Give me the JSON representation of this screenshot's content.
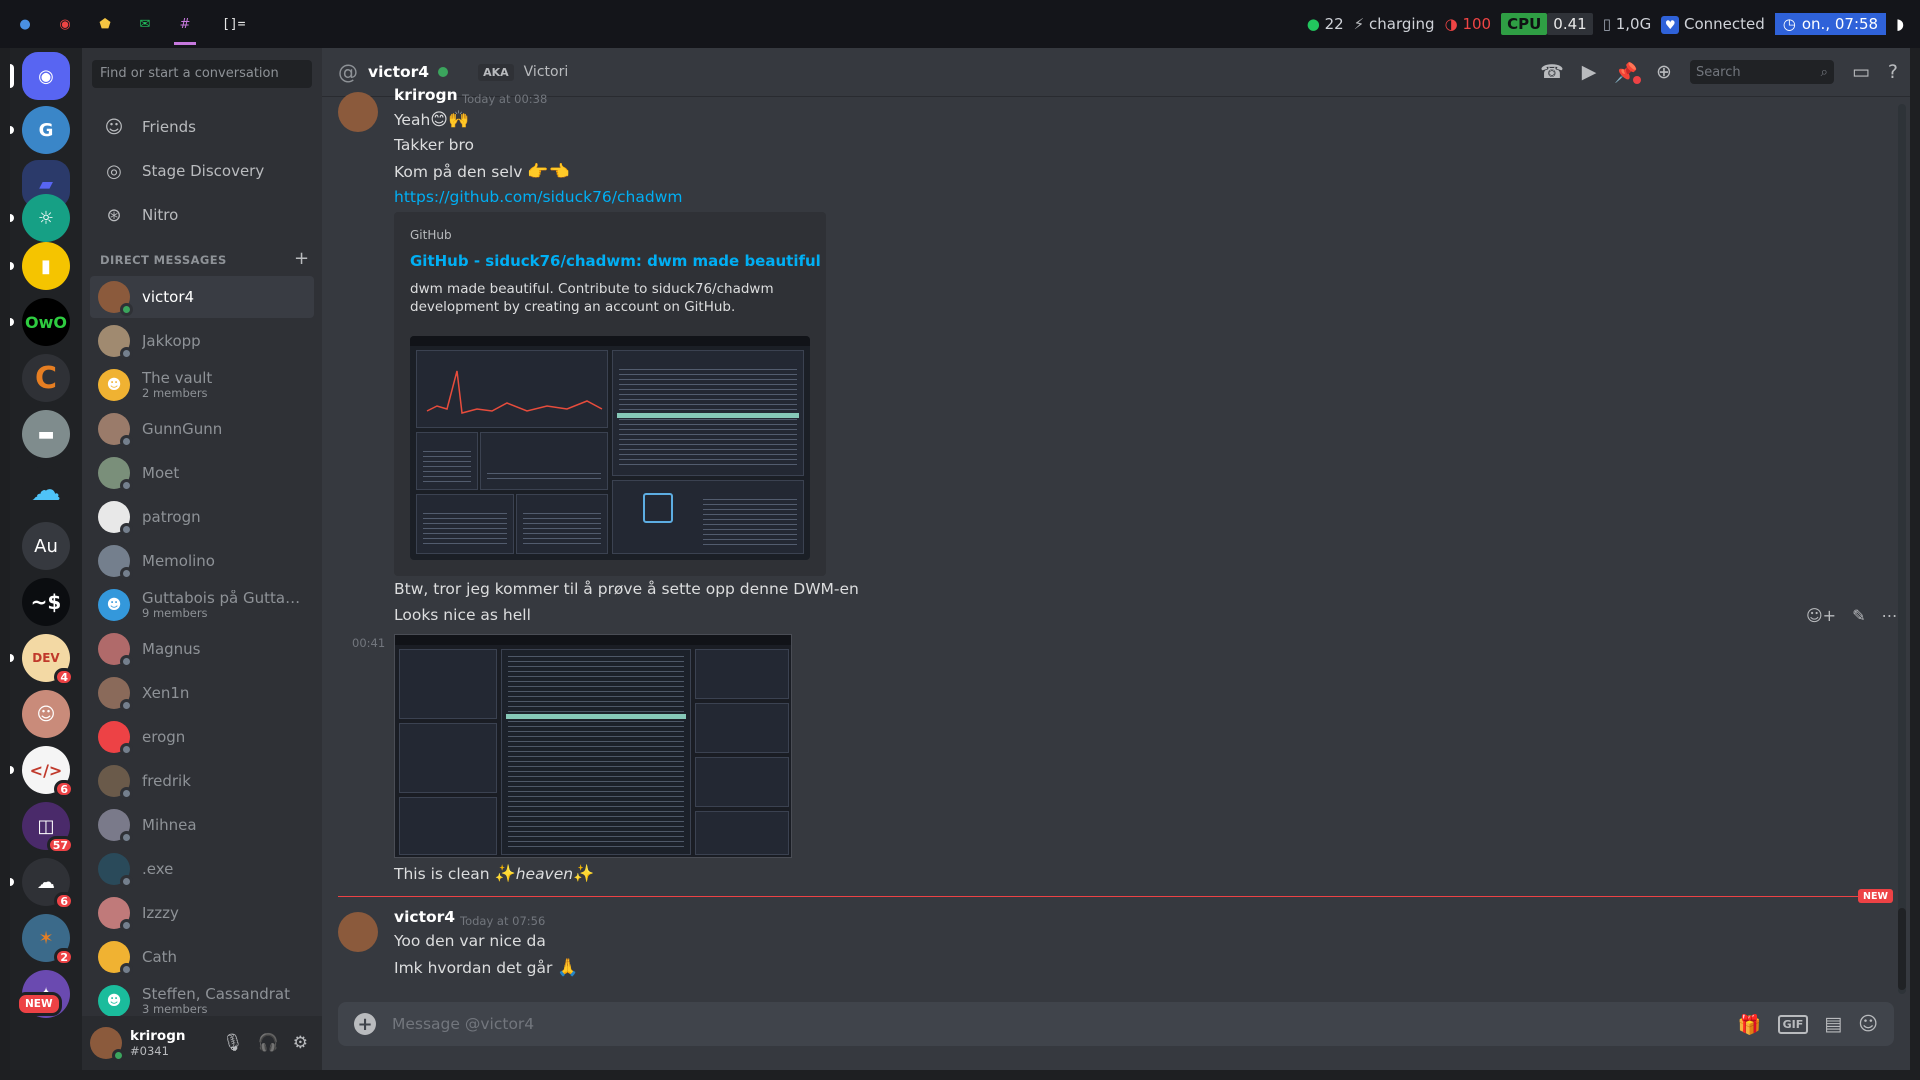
{
  "sysbar": {
    "layout_symbol": "[]=",
    "updates": "22",
    "battery_status": "charging",
    "battery_level": "100",
    "cpu_label": "CPU",
    "cpu_value": "0.41",
    "mem_value": "1,0G",
    "vpn_status": "Connected",
    "clock": "on., 07:58"
  },
  "servers": [
    {
      "name": "Discord Home",
      "badge": ""
    },
    {
      "name": "G",
      "badge": ""
    },
    {
      "name": "Folder",
      "badge": ""
    },
    {
      "name": "Owl server",
      "badge": ""
    },
    {
      "name": "Yellow server",
      "badge": ""
    },
    {
      "name": "OwO",
      "badge": ""
    },
    {
      "name": "Orange C",
      "badge": ""
    },
    {
      "name": "Car server",
      "badge": ""
    },
    {
      "name": "Cloud server",
      "badge": ""
    },
    {
      "name": "Au",
      "badge": ""
    },
    {
      "name": "~$",
      "badge": ""
    },
    {
      "name": "Bowser",
      "badge": "4"
    },
    {
      "name": "Face",
      "badge": ""
    },
    {
      "name": "Code",
      "badge": "6"
    },
    {
      "name": "Robot",
      "badge": "57"
    },
    {
      "name": "Weather",
      "badge": "6"
    },
    {
      "name": "Crab",
      "badge": "2"
    },
    {
      "name": "New",
      "badge": ""
    }
  ],
  "sidebar": {
    "search_placeholder": "Find or start a conversation",
    "nav": [
      {
        "label": "Friends"
      },
      {
        "label": "Stage Discovery"
      },
      {
        "label": "Nitro"
      }
    ],
    "dm_header": "DIRECT MESSAGES",
    "dms": [
      {
        "name": "victor4",
        "sub": "",
        "color": "#8b5a3c",
        "online": true
      },
      {
        "name": "Jakkopp",
        "sub": "",
        "color": "#a08a70",
        "online": false
      },
      {
        "name": "The vault",
        "sub": "2 members",
        "color": "#f0b232",
        "online": false
      },
      {
        "name": "GunnGunn",
        "sub": "",
        "color": "#9a7b6a",
        "online": false
      },
      {
        "name": "Moet",
        "sub": "",
        "color": "#7a8f7a",
        "online": false
      },
      {
        "name": "patrogn",
        "sub": "",
        "color": "#e8e8e8",
        "online": false
      },
      {
        "name": "Memolino",
        "sub": "",
        "color": "#747f8d",
        "online": false
      },
      {
        "name": "Guttabois på Guttatu...",
        "sub": "9 members",
        "color": "#3498db",
        "online": false
      },
      {
        "name": "Magnus",
        "sub": "",
        "color": "#b06a6a",
        "online": false
      },
      {
        "name": "Xen1n",
        "sub": "",
        "color": "#8a6a5a",
        "online": false
      },
      {
        "name": "erogn",
        "sub": "",
        "color": "#ed4245",
        "online": false
      },
      {
        "name": "fredrik",
        "sub": "",
        "color": "#6a5a4a",
        "online": false
      },
      {
        "name": "Mihnea",
        "sub": "",
        "color": "#7a7a8a",
        "online": false
      },
      {
        "name": ".exe",
        "sub": "",
        "color": "#2a4a5a",
        "online": false
      },
      {
        "name": "Izzzy",
        "sub": "",
        "color": "#c07a7a",
        "online": false
      },
      {
        "name": "Cath",
        "sub": "",
        "color": "#f0b232",
        "online": false
      },
      {
        "name": "Steffen, Cassandrat",
        "sub": "3 members",
        "color": "#1abc9c",
        "online": false
      }
    ]
  },
  "user": {
    "name": "krirogn",
    "tag": "#0341"
  },
  "chat": {
    "recipient": "victor4",
    "aka_label": "AKA",
    "aka_name": "Victori",
    "search_placeholder": "Search",
    "msg1": {
      "author": "krirogn",
      "time": "Today at 00:38",
      "lines": [
        "Yeah",
        "Takker bro",
        "Kom på den selv"
      ],
      "link": "https://github.com/siduck76/chadwm"
    },
    "embed": {
      "provider": "GitHub",
      "title": "GitHub - siduck76/chadwm: dwm made beautiful",
      "description": "dwm made beautiful. Contribute to siduck76/chadwm development by creating an account on GitHub."
    },
    "msg1_after": [
      "Btw, tror jeg kommer til å prøve å sette opp denne DWM-en",
      "Looks nice as hell"
    ],
    "msg1_time2": "00:41",
    "msg1_last_prefix": "This is clean ",
    "msg1_last_italic": "heaven",
    "new_label": "NEW",
    "msg2": {
      "author": "victor4",
      "time": "Today at 07:56",
      "lines": [
        "Yoo den var nice da",
        "Imk hvordan det går"
      ]
    },
    "composer_placeholder": "Message @victor4",
    "gif_label": "GIF"
  }
}
